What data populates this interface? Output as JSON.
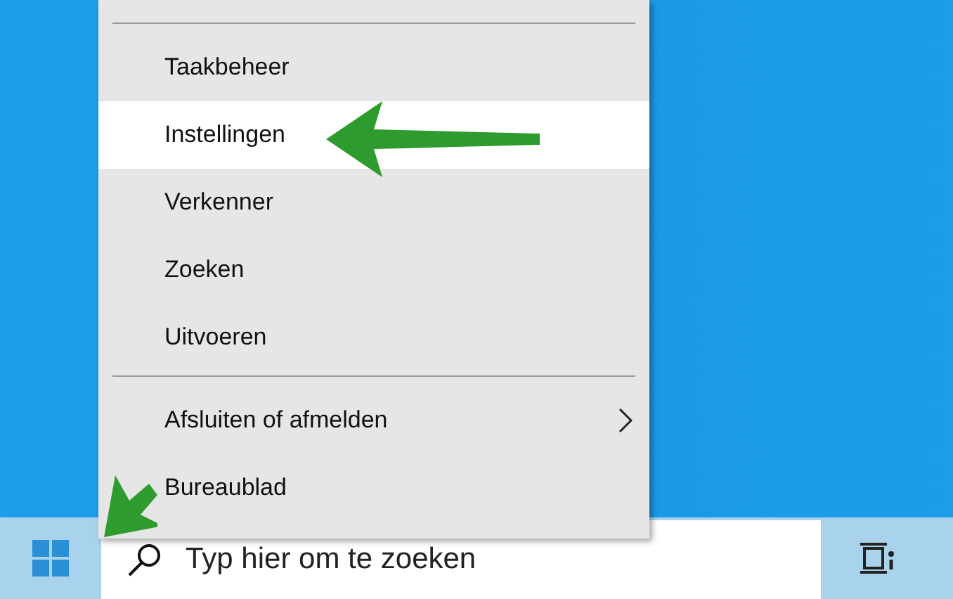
{
  "menu": {
    "groups": [
      {
        "items": [
          {
            "label": "Taakbeheer",
            "selected": false,
            "submenu": false
          },
          {
            "label": "Instellingen",
            "selected": true,
            "submenu": false
          },
          {
            "label": "Verkenner",
            "selected": false,
            "submenu": false
          },
          {
            "label": "Zoeken",
            "selected": false,
            "submenu": false
          },
          {
            "label": "Uitvoeren",
            "selected": false,
            "submenu": false
          }
        ]
      },
      {
        "items": [
          {
            "label": "Afsluiten of afmelden",
            "selected": false,
            "submenu": true
          },
          {
            "label": "Bureaublad",
            "selected": false,
            "submenu": false
          }
        ]
      }
    ]
  },
  "taskbar": {
    "search": {
      "placeholder": "Typ hier om te zoeken"
    }
  }
}
